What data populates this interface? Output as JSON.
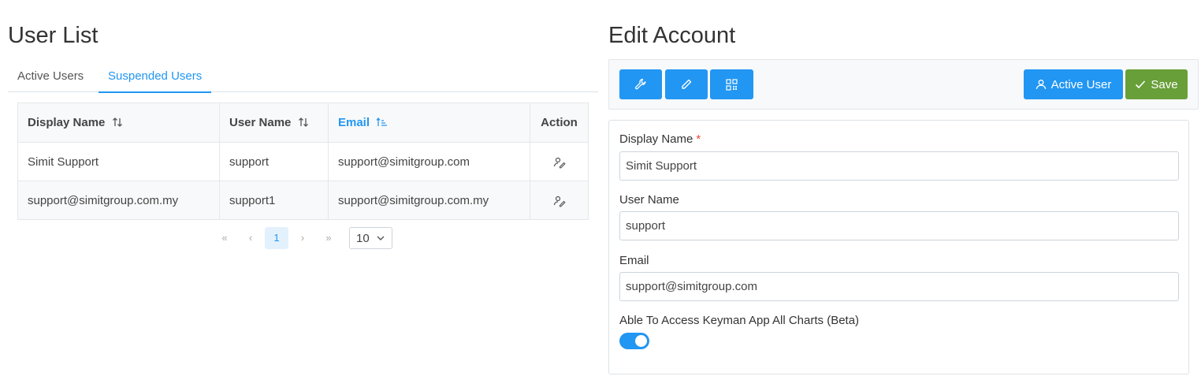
{
  "user_list": {
    "title": "User List",
    "tabs": [
      {
        "label": "Active Users",
        "active": false
      },
      {
        "label": "Suspended Users",
        "active": true
      }
    ],
    "table": {
      "columns": [
        {
          "label": "Display Name",
          "sort_icon": "sort-both-icon"
        },
        {
          "label": "User Name",
          "sort_icon": "sort-both-icon"
        },
        {
          "label": "Email",
          "sort_icon": "sort-ascending-icon"
        },
        {
          "label": "Action"
        }
      ],
      "rows": [
        {
          "display_name": "Simit Support",
          "user_name": "support",
          "email": "support@simitgroup.com",
          "action_icon": "user-edit-icon"
        },
        {
          "display_name": "support@simitgroup.com.my",
          "user_name": "support1",
          "email": "support@simitgroup.com.my",
          "action_icon": "user-edit-icon"
        }
      ]
    },
    "pagination": {
      "first": "«",
      "prev": "‹",
      "current_page": "1",
      "next": "›",
      "last": "»",
      "page_size": "10"
    }
  },
  "edit_account": {
    "title": "Edit Account",
    "toolbar": {
      "icon_buttons": [
        "wrench-icon",
        "pencil-icon",
        "qrcode-icon"
      ],
      "active_user_label": "Active User",
      "save_label": "Save"
    },
    "form": {
      "display_name": {
        "label": "Display Name",
        "required_mark": "*",
        "value": "Simit Support"
      },
      "user_name": {
        "label": "User Name",
        "value": "support"
      },
      "email": {
        "label": "Email",
        "value": "support@simitgroup.com"
      },
      "charts_access": {
        "label": "Able To Access Keyman App All Charts (Beta)",
        "enabled": true
      }
    }
  },
  "colors": {
    "primary": "#2196f3",
    "success": "#689f38",
    "required": "#e74c3c"
  }
}
